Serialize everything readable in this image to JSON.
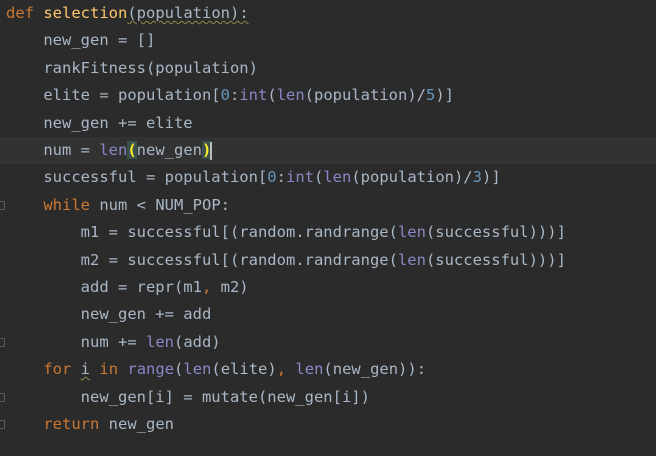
{
  "editor": {
    "lines": [
      {
        "tokens": [
          {
            "t": "def",
            "c": "kw"
          },
          {
            "t": " "
          },
          {
            "t": "selection",
            "c": "fn"
          },
          {
            "t": "(population):",
            "c": "warn"
          }
        ]
      },
      {
        "tokens": [
          {
            "t": "    new_gen = []"
          }
        ]
      },
      {
        "tokens": [
          {
            "t": "    rankFitness(population)"
          }
        ]
      },
      {
        "tokens": [
          {
            "t": "    elite = population["
          },
          {
            "t": "0",
            "c": "num"
          },
          {
            "t": ":"
          },
          {
            "t": "int",
            "c": "bi"
          },
          {
            "t": "("
          },
          {
            "t": "len",
            "c": "bi"
          },
          {
            "t": "(population)/"
          },
          {
            "t": "5",
            "c": "num"
          },
          {
            "t": ")]"
          }
        ]
      },
      {
        "tokens": [
          {
            "t": "    new_gen += elite"
          }
        ]
      },
      {
        "current": true,
        "tokens": [
          {
            "t": "    num = "
          },
          {
            "t": "len",
            "c": "bi"
          },
          {
            "t": "(",
            "c": "bm"
          },
          {
            "t": "new_gen"
          },
          {
            "t": ")",
            "c": "bm"
          },
          {
            "caret": true
          }
        ]
      },
      {
        "tokens": [
          {
            "t": "    successful = population["
          },
          {
            "t": "0",
            "c": "num"
          },
          {
            "t": ":"
          },
          {
            "t": "int",
            "c": "bi"
          },
          {
            "t": "("
          },
          {
            "t": "len",
            "c": "bi"
          },
          {
            "t": "(population)/"
          },
          {
            "t": "3",
            "c": "num"
          },
          {
            "t": ")]"
          }
        ]
      },
      {
        "fold": true,
        "tokens": [
          {
            "t": "    "
          },
          {
            "t": "while",
            "c": "kw"
          },
          {
            "t": " num < NUM_POP:"
          }
        ]
      },
      {
        "tokens": [
          {
            "t": "        m1 = successful[(random.randrange("
          },
          {
            "t": "len",
            "c": "bi"
          },
          {
            "t": "(successful)))]"
          }
        ]
      },
      {
        "tokens": [
          {
            "t": "        m2 = successful[(random.randrange("
          },
          {
            "t": "len",
            "c": "bi"
          },
          {
            "t": "(successful)))]"
          }
        ]
      },
      {
        "tokens": [
          {
            "t": "        add = repr(m1"
          },
          {
            "t": ",",
            "c": "kw"
          },
          {
            "t": " m2)"
          }
        ]
      },
      {
        "tokens": [
          {
            "t": "        new_gen += add"
          }
        ]
      },
      {
        "fold": true,
        "tokens": [
          {
            "t": "        num += "
          },
          {
            "t": "len",
            "c": "bi"
          },
          {
            "t": "(add)"
          }
        ]
      },
      {
        "tokens": [
          {
            "t": "    "
          },
          {
            "t": "for",
            "c": "kw"
          },
          {
            "t": " "
          },
          {
            "t": "i",
            "c": "warn"
          },
          {
            "t": " "
          },
          {
            "t": "in",
            "c": "kw"
          },
          {
            "t": " "
          },
          {
            "t": "range",
            "c": "bi"
          },
          {
            "t": "("
          },
          {
            "t": "len",
            "c": "bi"
          },
          {
            "t": "(elite)"
          },
          {
            "t": ",",
            "c": "kw"
          },
          {
            "t": " "
          },
          {
            "t": "len",
            "c": "bi"
          },
          {
            "t": "(new_gen)):"
          }
        ]
      },
      {
        "fold": true,
        "tokens": [
          {
            "t": "        new_gen[i] = mutate(new_gen[i])"
          }
        ]
      },
      {
        "fold": true,
        "tokens": [
          {
            "t": "    "
          },
          {
            "t": "return",
            "c": "kw"
          },
          {
            "t": " new_gen"
          }
        ]
      }
    ]
  }
}
